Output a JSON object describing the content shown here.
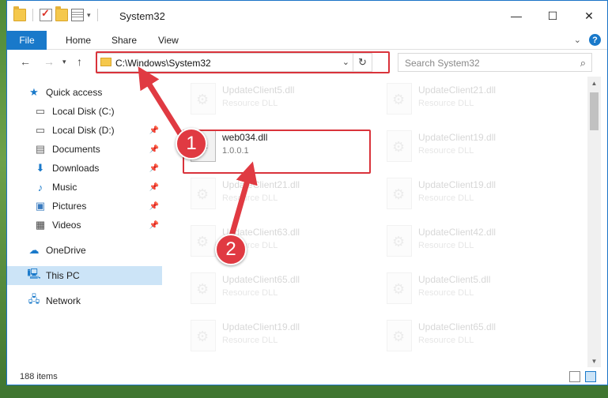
{
  "window": {
    "title": "System32",
    "controls": {
      "minimize": "—",
      "maximize": "☐",
      "close": "✕"
    }
  },
  "ribbon": {
    "tabs": [
      "File",
      "Home",
      "Share",
      "View"
    ]
  },
  "address": {
    "path": "C:\\Windows\\System32",
    "search_placeholder": "Search System32"
  },
  "nav": {
    "items": [
      {
        "label": "Quick access",
        "icon": "star-icon"
      },
      {
        "label": "Local Disk (C:)",
        "icon": "drive-icon"
      },
      {
        "label": "Local Disk (D:)",
        "icon": "drive-icon"
      },
      {
        "label": "Documents",
        "icon": "documents-icon"
      },
      {
        "label": "Downloads",
        "icon": "downloads-icon"
      },
      {
        "label": "Music",
        "icon": "music-icon"
      },
      {
        "label": "Pictures",
        "icon": "pictures-icon"
      },
      {
        "label": "Videos",
        "icon": "videos-icon"
      },
      {
        "label": "OneDrive",
        "icon": "cloud-icon"
      },
      {
        "label": "This PC",
        "icon": "computer-icon"
      },
      {
        "label": "Network",
        "icon": "network-icon"
      }
    ]
  },
  "files": {
    "left": [
      {
        "name": "UpdateClient5.dll",
        "type": "Resource DLL"
      },
      {
        "name": "web034.dll",
        "type": "1.0.0.1"
      },
      {
        "name": "UpdateClient21.dll",
        "type": "Resource DLL"
      },
      {
        "name": "UpdateClient63.dll",
        "type": "Resource DLL"
      },
      {
        "name": "UpdateClient65.dll",
        "type": "Resource DLL"
      },
      {
        "name": "UpdateClient19.dll",
        "type": "Resource DLL"
      }
    ],
    "right": [
      {
        "name": "UpdateClient21.dll",
        "type": "Resource DLL"
      },
      {
        "name": "UpdateClient19.dll",
        "type": "Resource DLL"
      },
      {
        "name": "UpdateClient19.dll",
        "type": "Resource DLL"
      },
      {
        "name": "UpdateClient42.dll",
        "type": "Resource DLL"
      },
      {
        "name": "UpdateClient5.dll",
        "type": "Resource DLL"
      },
      {
        "name": "UpdateClient65.dll",
        "type": "Resource DLL"
      }
    ]
  },
  "status": {
    "item_count": "188 items"
  },
  "annotations": {
    "step1": "1",
    "step2": "2",
    "color": "#e03a42"
  }
}
